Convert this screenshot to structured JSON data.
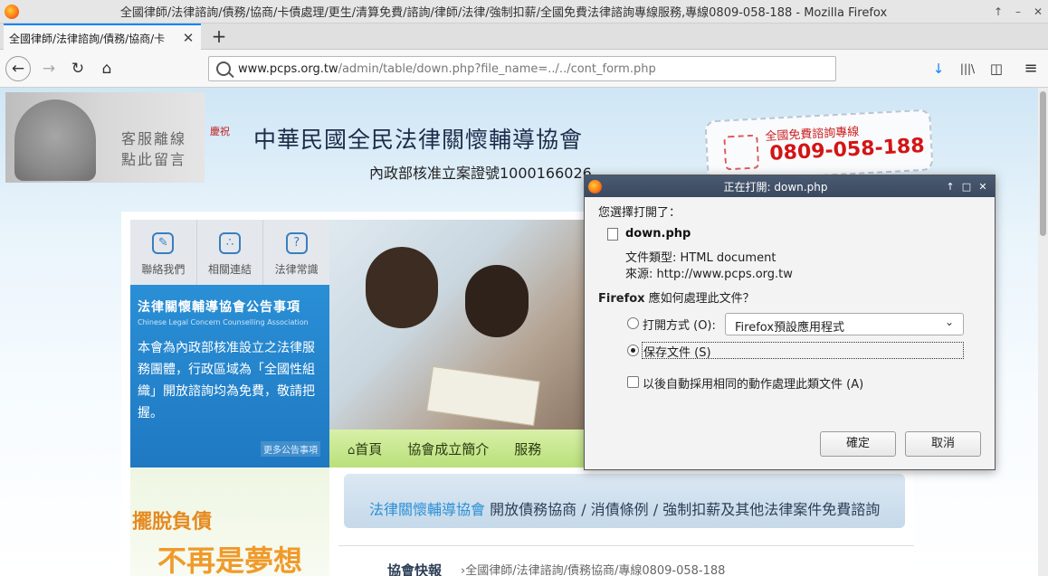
{
  "window": {
    "title": "全國律師/法律諮詢/債務/協商/卡債處理/更生/清算免費/諮詢/律師/法律/強制扣薪/全國免費法律諮詢專線服務,專線0809-058-188 - Mozilla Firefox",
    "controls": {
      "up": "↑",
      "minimize": "–",
      "close": "✕"
    }
  },
  "tab": {
    "title": "全國律師/法律諮詢/債務/協商/卡",
    "close": "✕",
    "new_tab": "+"
  },
  "nav": {
    "back": "←",
    "forward": "→",
    "reload": "↻",
    "home": "⌂",
    "url_host": "www.pcps.org.tw",
    "url_path": "/admin/table/down.php?file_name=../../cont_form.php",
    "download": "↓",
    "library": "|||\\",
    "sidebar": "◫",
    "menu": "≡"
  },
  "page": {
    "support_text_line1": "客服離線",
    "support_text_line2": "點此留言",
    "org_name": "中華民國全民法律關懷輔導協會",
    "org_reg": "內政部核准立案證號1000166026",
    "deco_mark": "慶祝",
    "hotline_label": "全國免費諮詢專線",
    "hotline_number": "0809-058-188",
    "icons": [
      {
        "label": "聯絡我們",
        "glyph": "✎"
      },
      {
        "label": "相關連結",
        "glyph": "∴"
      },
      {
        "label": "法律常識",
        "glyph": "?"
      }
    ],
    "notice_title": "法律關懷輔導協會公告事項",
    "notice_subtitle": "Chinese Legal Concern Counselling Association",
    "notice_body": "本會為內政部核准設立之法律服務團體，行政區域為「全國性組織」開放諮詢均為免費，敬請把握。",
    "notice_more": "更多公告事項",
    "menu": [
      "首頁",
      "協會成立簡介",
      "服務"
    ],
    "slogan_line1": "擺脫負債",
    "slogan_line2": "不再是夢想",
    "banner_org": "法律關懷輔導協會",
    "banner_rest": " 開放債務協商 / 消債條例 / 強制扣薪及其他法律案件免費諮詢",
    "news_label": "協會快報",
    "news_text": "›全國律師/法律諮詢/債務協商/專線0809-058-188"
  },
  "dialog": {
    "title": "正在打開: down.php",
    "prompt": "您選擇打開了：",
    "file_name": "down.php",
    "file_type": "文件類型: HTML document",
    "file_from": "來源: http://www.pcps.org.tw",
    "question_prefix": "Firefox",
    "question_rest": " 應如何處理此文件？",
    "open_with_label": "打開方式 (O):",
    "open_with_value": "Firefox預設應用程式",
    "save_label": "保存文件 (S)",
    "remember_label": "以後自動採用相同的動作處理此類文件 (A)",
    "ok": "確定",
    "cancel": "取消"
  }
}
